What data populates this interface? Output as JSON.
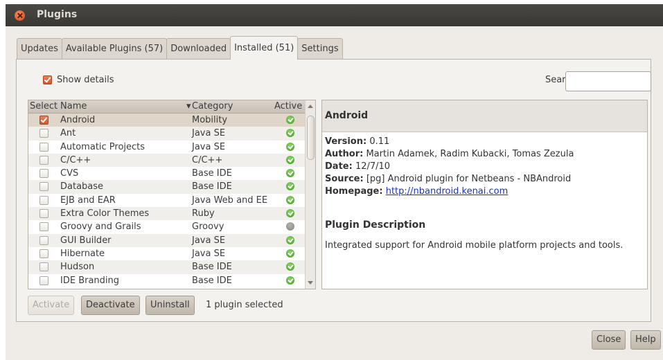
{
  "window": {
    "title": "Plugins"
  },
  "tabs": [
    {
      "label": "Updates",
      "active": false
    },
    {
      "label": "Available Plugins (57)",
      "active": false
    },
    {
      "label": "Downloaded",
      "active": false
    },
    {
      "label": "Installed (51)",
      "active": true
    },
    {
      "label": "Settings",
      "active": false
    }
  ],
  "toolbar": {
    "show_details_label": "Show details",
    "show_details_checked": true,
    "search_label": "Search:",
    "search_value": ""
  },
  "table": {
    "headers": {
      "select": "Select",
      "name": "Name",
      "category": "Category",
      "active": "Active"
    },
    "rows": [
      {
        "checked": true,
        "name": "Android",
        "category": "Mobility",
        "active": true,
        "selected": true
      },
      {
        "checked": false,
        "name": "Ant",
        "category": "Java SE",
        "active": true
      },
      {
        "checked": false,
        "name": "Automatic Projects",
        "category": "Java SE",
        "active": true
      },
      {
        "checked": false,
        "name": "C/C++",
        "category": "C/C++",
        "active": true
      },
      {
        "checked": false,
        "name": "CVS",
        "category": "Base IDE",
        "active": true
      },
      {
        "checked": false,
        "name": "Database",
        "category": "Base IDE",
        "active": true
      },
      {
        "checked": false,
        "name": "EJB and EAR",
        "category": "Java Web and EE",
        "active": true
      },
      {
        "checked": false,
        "name": "Extra Color Themes",
        "category": "Ruby",
        "active": true
      },
      {
        "checked": false,
        "name": "Groovy and Grails",
        "category": "Groovy",
        "active": false
      },
      {
        "checked": false,
        "name": "GUI Builder",
        "category": "Java SE",
        "active": true
      },
      {
        "checked": false,
        "name": "Hibernate",
        "category": "Java SE",
        "active": true
      },
      {
        "checked": false,
        "name": "Hudson",
        "category": "Base IDE",
        "active": true
      },
      {
        "checked": false,
        "name": "IDE Branding",
        "category": "Base IDE",
        "active": true
      }
    ]
  },
  "detail": {
    "title": "Android",
    "version_label": "Version:",
    "version": "0.11",
    "author_label": "Author:",
    "author": "Martin Adamek, Radim Kubacki, Tomas Zezula",
    "date_label": "Date:",
    "date": "12/7/10",
    "source_label": "Source:",
    "source": "[pg] Android plugin for Netbeans - NBAndroid",
    "homepage_label": "Homepage:",
    "homepage": "http://nbandroid.kenai.com",
    "description_heading": "Plugin Description",
    "description": "Integrated support for Android mobile platform projects and tools."
  },
  "actions": {
    "activate": "Activate",
    "deactivate": "Deactivate",
    "uninstall": "Uninstall",
    "status": "1 plugin selected"
  },
  "footer": {
    "close": "Close",
    "help": "Help"
  }
}
